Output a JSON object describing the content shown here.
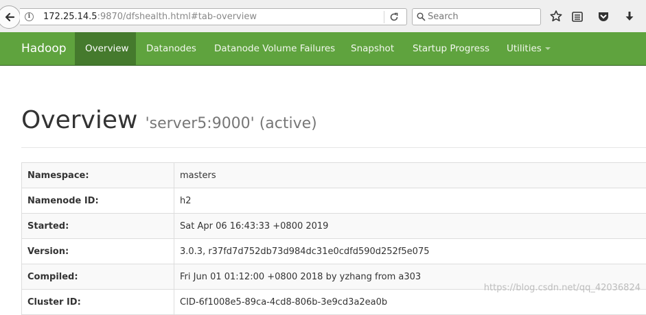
{
  "browser": {
    "url_host": "172.25.14.5",
    "url_rest": ":9870/dfshealth.html#tab-overview",
    "search_placeholder": "Search"
  },
  "navbar": {
    "brand": "Hadoop",
    "items": [
      {
        "label": "Overview"
      },
      {
        "label": "Datanodes"
      },
      {
        "label": "Datanode Volume Failures"
      },
      {
        "label": "Snapshot"
      },
      {
        "label": "Startup Progress"
      },
      {
        "label": "Utilities"
      }
    ]
  },
  "page": {
    "title": "Overview",
    "subtitle": "'server5:9000' (active)"
  },
  "overview_table": [
    {
      "key": "Namespace:",
      "value": "masters"
    },
    {
      "key": "Namenode ID:",
      "value": "h2"
    },
    {
      "key": "Started:",
      "value": "Sat Apr 06 16:43:33 +0800 2019"
    },
    {
      "key": "Version:",
      "value": "3.0.3, r37fd7d752db73d984dc31e0cdfd590d252f5e075"
    },
    {
      "key": "Compiled:",
      "value": "Fri Jun 01 01:12:00 +0800 2018 by yzhang from a303"
    },
    {
      "key": "Cluster ID:",
      "value": "CID-6f1008e5-89ca-4cd8-806b-3e9cd3a2ea0b"
    }
  ],
  "watermark": "https://blog.csdn.net/qq_42036824",
  "colors": {
    "navbar": "#5fa33e",
    "navbar_active": "#457a2d"
  }
}
